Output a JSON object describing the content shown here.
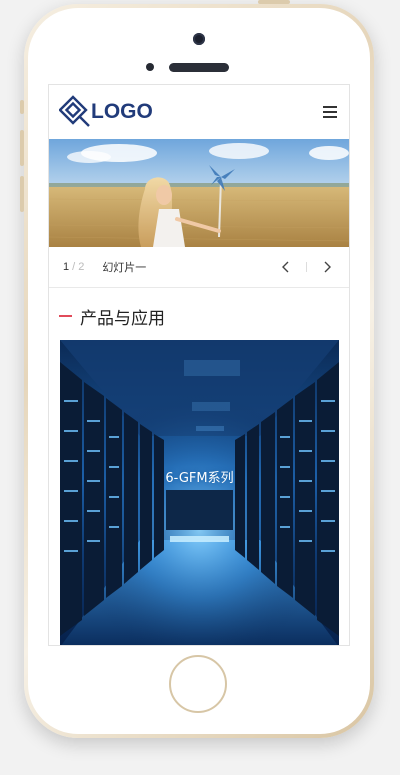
{
  "header": {
    "logo_text": "LOGO",
    "menu_icon": "hamburger-menu-icon"
  },
  "slider": {
    "current": "1",
    "separator": "/",
    "total": "2",
    "caption": "幻灯片一",
    "prev_icon": "chevron-left-icon",
    "next_icon": "chevron-right-icon"
  },
  "products": {
    "section_title": "产品与应用",
    "items": [
      {
        "label": "6-GFM系列"
      }
    ]
  },
  "colors": {
    "brand": "#213b7a",
    "accent": "#e14b5a",
    "phone_frame": "#e6d6bb"
  }
}
